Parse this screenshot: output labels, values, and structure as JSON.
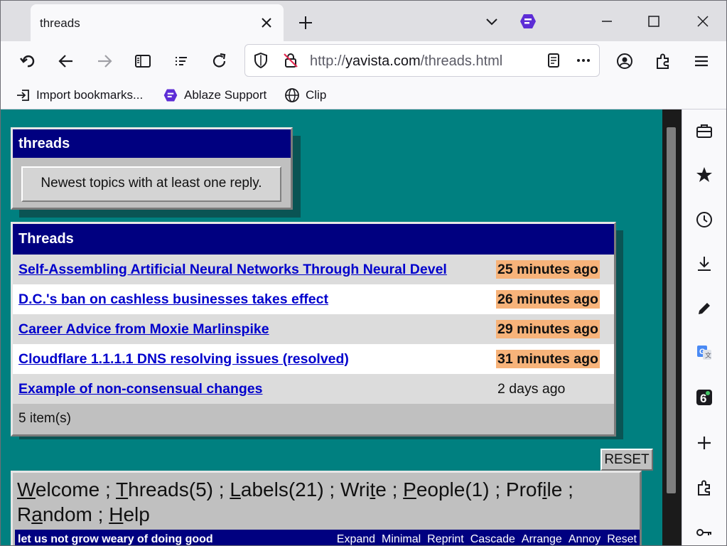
{
  "browser": {
    "tab_title": "threads",
    "url_prefix": "http://",
    "url_domain": "yavista.com",
    "url_path": "/threads.html",
    "bookmarks": [
      {
        "label": "Import bookmarks...",
        "icon": "import-icon"
      },
      {
        "label": "Ablaze Support",
        "icon": "ablaze-icon"
      },
      {
        "label": "Clip",
        "icon": "globe-icon"
      }
    ],
    "sidebar_icons": [
      "toolbox-icon",
      "star-icon",
      "clock-icon",
      "download-icon",
      "pen-icon",
      "translate-icon",
      "extension-6-icon",
      "plus-icon",
      "puzzle-icon",
      "key-icon"
    ]
  },
  "page": {
    "header_panel": {
      "title": "threads",
      "description": "Newest topics with at least one reply."
    },
    "threads_panel": {
      "title": "Threads",
      "items": [
        {
          "title": "Self-Assembling Artificial Neural Networks Through Neural Devel",
          "time": "25 minutes ago",
          "recent": true
        },
        {
          "title": "D.C.'s ban on cashless businesses takes effect",
          "time": "26 minutes ago",
          "recent": true
        },
        {
          "title": "Career Advice from Moxie Marlinspike",
          "time": "29 minutes ago",
          "recent": true
        },
        {
          "title": "Cloudflare 1.1.1.1 DNS resolving issues (resolved)",
          "time": "31 minutes ago",
          "recent": true
        },
        {
          "title": "Example of non-consensual changes",
          "time": "2 days ago",
          "recent": false
        }
      ],
      "footer": "5 item(s)"
    },
    "reset_label": "RESET",
    "menu": {
      "items": [
        {
          "first": "W",
          "rest": "elcome"
        },
        {
          "first": "T",
          "rest": "hreads(5)"
        },
        {
          "first": "L",
          "rest": "abels(21)"
        },
        {
          "first": "",
          "pre": "Wri",
          "mid": "t",
          "rest": "e"
        },
        {
          "first": "P",
          "rest": "eople(1)"
        },
        {
          "first": "",
          "pre": "Prof",
          "mid": "i",
          "rest": "le"
        },
        {
          "first": "",
          "pre": "R",
          "mid": "a",
          "rest": "ndom"
        },
        {
          "first": "H",
          "rest": "elp"
        }
      ],
      "motto": "let us not grow weary of doing good",
      "links": [
        "Expand",
        "Minimal",
        "Reprint",
        "Cascade",
        "Arrange",
        "Annoy",
        "Reset"
      ]
    }
  },
  "colors": {
    "background": "#008080",
    "title_bar": "#000080",
    "panel": "#c0c0c0",
    "link": "#0000cc",
    "recent_highlight": "#f7b37a"
  }
}
